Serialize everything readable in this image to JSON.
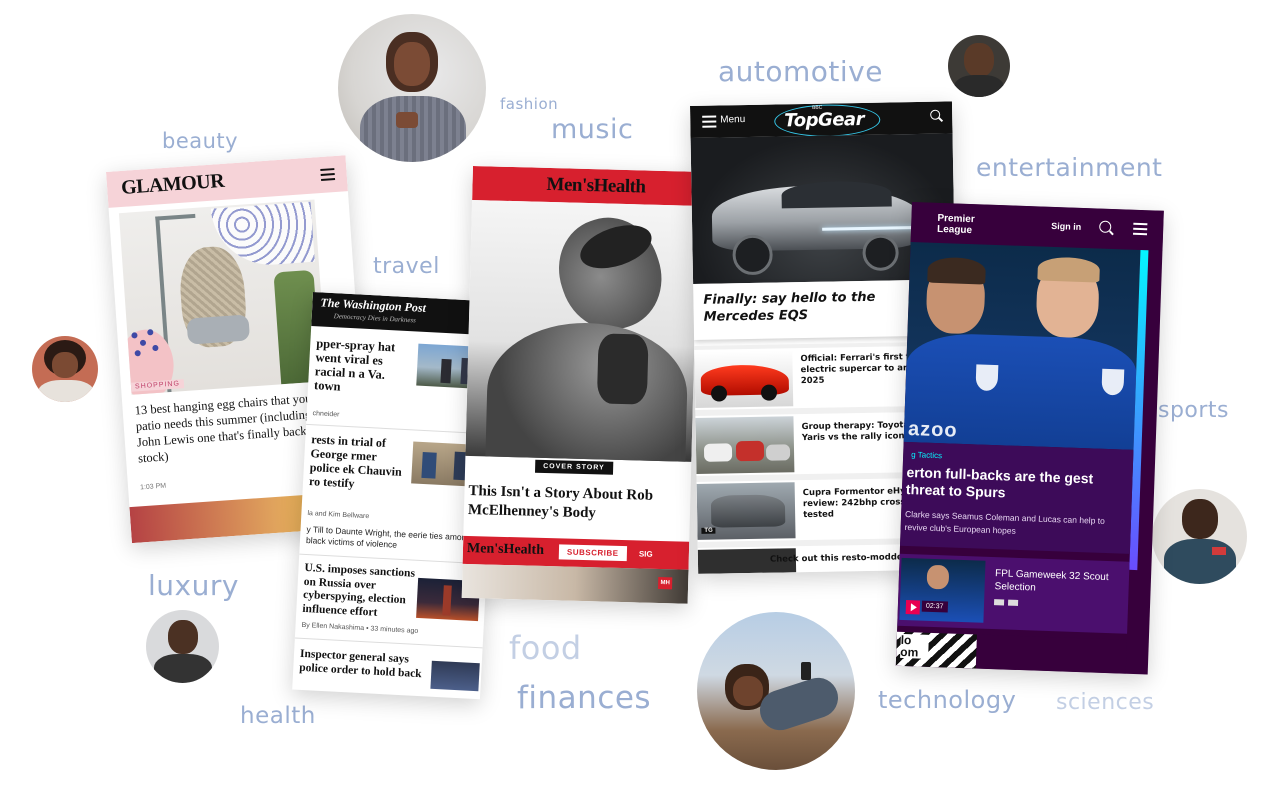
{
  "keywords": {
    "beauty": "beauty",
    "fashion": "fashion",
    "music": "music",
    "automotive": "automotive",
    "entertainment": "entertainment",
    "travel": "travel",
    "sports": "sports",
    "luxury": "luxury",
    "health": "health",
    "food": "food",
    "finances": "finances",
    "technology": "technology",
    "sciences": "sciences"
  },
  "glamour": {
    "logo": "GLAMOUR",
    "tag": "SHOPPING",
    "headline": "13 best hanging egg chairs that your patio needs this summer (including the John Lewis one that's finally back in stock)",
    "time": "1:03 PM"
  },
  "wapo": {
    "logo": "The Washington Post",
    "tagline": "Democracy Dies in Darkness",
    "story1": "pper-spray hat went viral es racial n a Va. town",
    "story1_byline": "chneider",
    "story2": "rests in trial of George rmer police ek Chauvin ro testify",
    "story2_byline": "la and Kim Bellware",
    "story2_sub": "y Till to Daunte Wright, the eerie ties among black victims of violence",
    "story3": "U.S. imposes sanctions on Russia over cyberspying, election influence effort",
    "story3_byline": "By Ellen Nakashima",
    "story3_time": "33 minutes ago",
    "story4": "Inspector general says police order to hold back"
  },
  "menshealth": {
    "logo": "Men'sHealth",
    "cover_tag": "COVER STORY",
    "headline": "This Isn't a Story About Rob McElhenney's Body",
    "footer_logo": "Men'sHealth",
    "subscribe": "SUBSCRIBE",
    "sign": "SIG",
    "badge": "MH"
  },
  "topgear": {
    "menu": "Menu",
    "bbc": "BBC",
    "logo": "TopGear",
    "hero_headline": "Finally: say hello to the Mercedes EQS",
    "items": [
      "Official: Ferrari's first fully electric supercar to arrive in 2025",
      "Group therapy: Toyota GR Yaris vs the rally icons",
      "Cupra Formentor eHybrid VZ2 review: 242bhp crossover tested",
      "Check out this resto-modded"
    ],
    "tg_badge": "TG"
  },
  "premier": {
    "logo_line1": "Premier",
    "logo_line2": "League",
    "sign_in": "Sign in",
    "category": "g Tactics",
    "headline": "erton full-backs are the gest threat to Spurs",
    "summary": "Clarke says Seamus Coleman and Lucas can help to revive club's European hopes",
    "video_title": "FPL Gameweek 32 Scout Selection",
    "duration": "02:37",
    "promo_text": "lo om",
    "shirt_text": "azoo"
  },
  "colors": {
    "keyword": "#9aaed2",
    "glamour_pink": "#f6d3d8",
    "mh_red": "#d7202e",
    "pl_purple": "#37003c",
    "pl_pink": "#e90052",
    "pl_cyan": "#04f5ff",
    "tg_black": "#111111"
  }
}
